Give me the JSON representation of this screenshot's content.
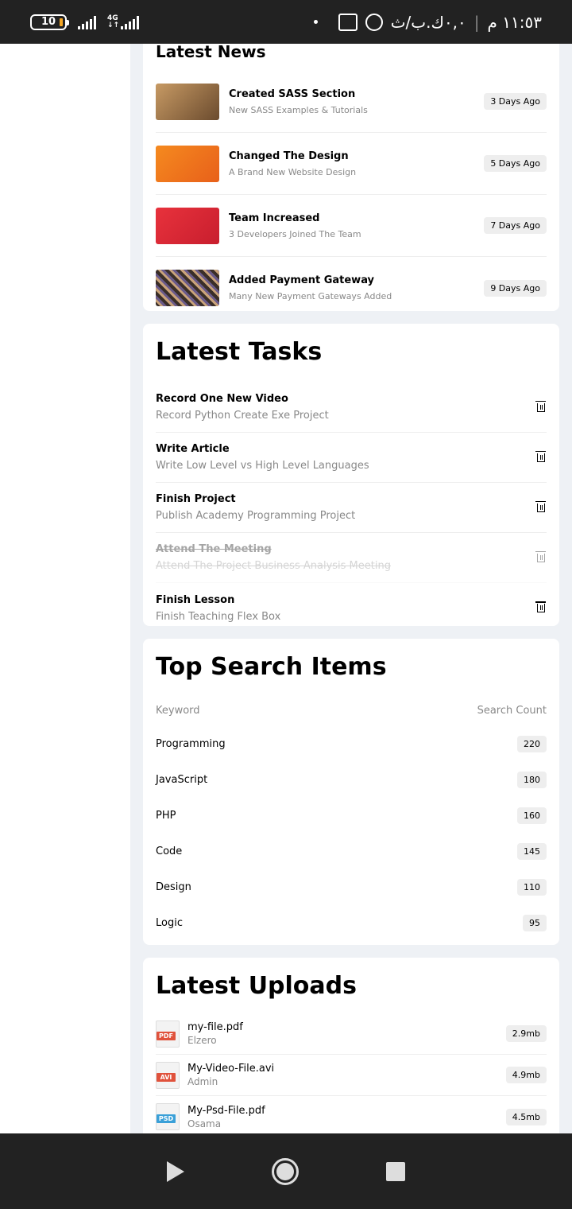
{
  "statusbar": {
    "battery": "10",
    "net": "4G",
    "time": "١١:٥٣ م",
    "info": "٠,٠ك.ب/ث"
  },
  "news": {
    "title": "Latest News",
    "items": [
      {
        "title": "Created SASS Section",
        "sub": "New SASS Examples & Tutorials",
        "badge": "3 Days Ago",
        "color": "#b58b5a"
      },
      {
        "title": "Changed The Design",
        "sub": "A Brand New Website Design",
        "badge": "5 Days Ago",
        "color": "#f07a1a"
      },
      {
        "title": "Team Increased",
        "sub": "3 Developers Joined The Team",
        "badge": "7 Days Ago",
        "color": "#e23a3f"
      },
      {
        "title": "Added Payment Gateway",
        "sub": "Many New Payment Gateways Added",
        "badge": "9 Days Ago",
        "color": "#5b4a3c"
      }
    ]
  },
  "tasks": {
    "title": "Latest Tasks",
    "items": [
      {
        "title": "Record One New Video",
        "sub": "Record Python Create Exe Project"
      },
      {
        "title": "Write Article",
        "sub": "Write Low Level vs High Level Languages"
      },
      {
        "title": "Finish Project",
        "sub": "Publish Academy Programming Project"
      },
      {
        "title": "Attend The Meeting",
        "sub": "Attend The Project Business Analysis Meeting"
      },
      {
        "title": "Finish Lesson",
        "sub": "Finish Teaching Flex Box"
      }
    ]
  },
  "search": {
    "title": "Top Search Items",
    "col1": "Keyword",
    "col2": "Search Count",
    "rows": [
      {
        "k": "Programming",
        "c": "220"
      },
      {
        "k": "JavaScript",
        "c": "180"
      },
      {
        "k": "PHP",
        "c": "160"
      },
      {
        "k": "Code",
        "c": "145"
      },
      {
        "k": "Design",
        "c": "110"
      },
      {
        "k": "Logic",
        "c": "95"
      }
    ]
  },
  "uploads": {
    "title": "Latest Uploads",
    "items": [
      {
        "name": "my-file.pdf",
        "by": "Elzero",
        "size": "2.9mb",
        "type": "PDF",
        "color": "#e0523c"
      },
      {
        "name": "My-Video-File.avi",
        "by": "Admin",
        "size": "4.9mb",
        "type": "AVI",
        "color": "#e0523c"
      },
      {
        "name": "My-Psd-File.pdf",
        "by": "Osama",
        "size": "4.5mb",
        "type": "PSD",
        "color": "#3aa0d8"
      }
    ]
  }
}
